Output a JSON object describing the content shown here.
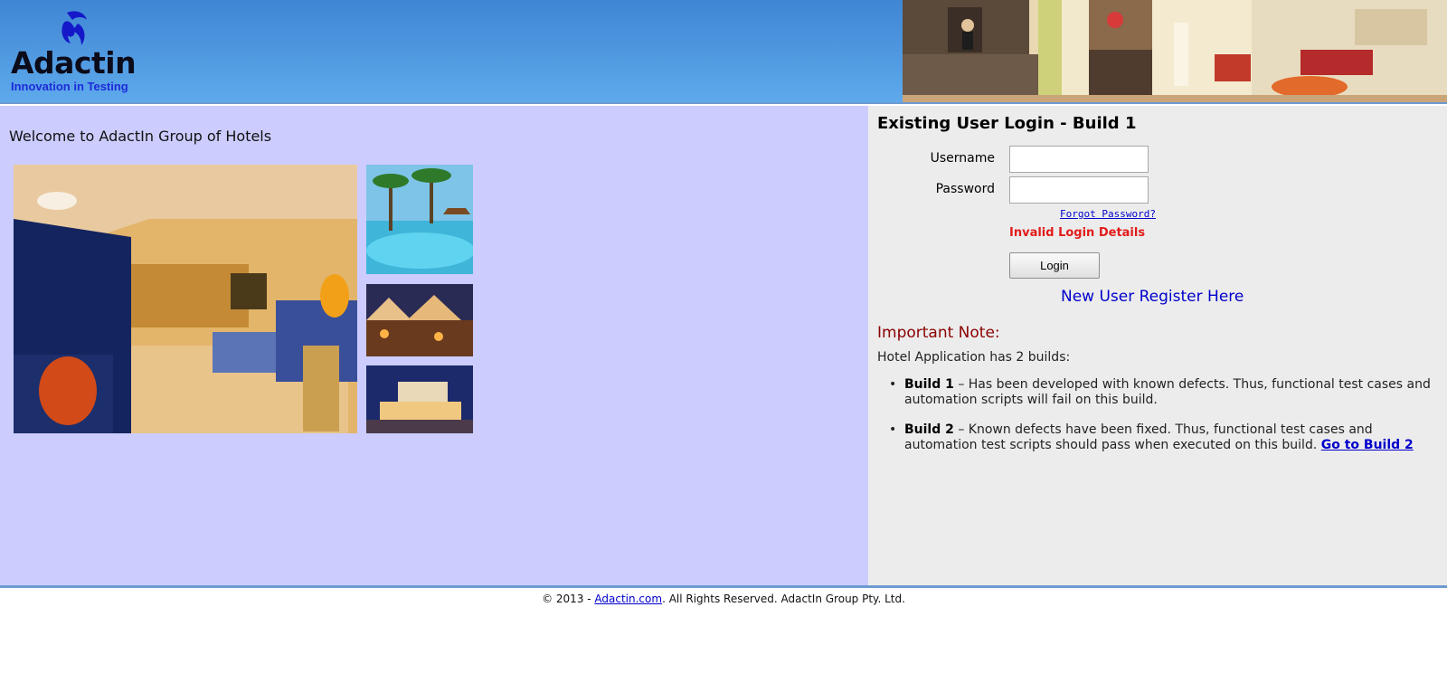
{
  "header": {
    "brand_name": "Adactin",
    "tagline": "Innovation in Testing"
  },
  "left": {
    "welcome": "Welcome to AdactIn Group of Hotels"
  },
  "login": {
    "title": "Existing User Login - Build 1",
    "username_label": "Username",
    "password_label": "Password",
    "username_value": "",
    "password_value": "",
    "forgot_label": "Forgot Password?",
    "error": "Invalid Login Details",
    "button_label": "Login",
    "register_label": "New User Register Here"
  },
  "note": {
    "title": "Important Note:",
    "intro": "Hotel Application has 2 builds:",
    "builds": [
      {
        "name": "Build 1",
        "text": " – Has been developed with known defects. Thus, functional test cases and automation scripts will fail on this build."
      },
      {
        "name": "Build 2",
        "text": " – Known defects have been fixed. Thus, functional test cases and automation test scripts should pass when executed on this build. ",
        "link": "Go to Build 2"
      }
    ]
  },
  "footer": {
    "prefix": "© 2013 - ",
    "link": "Adactin.com",
    "suffix": ". All Rights Reserved. AdactIn Group Pty. Ltd."
  },
  "colors": {
    "header_blue": "#3f86d3",
    "left_panel": "#ccccff",
    "right_panel": "#ececec",
    "error_red": "#e21b1b",
    "note_red": "#8b0000",
    "link_blue": "#0000cc"
  }
}
